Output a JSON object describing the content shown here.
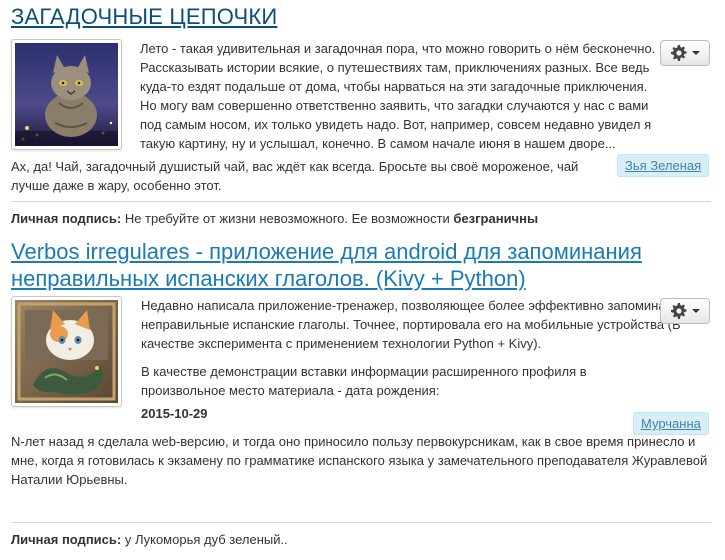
{
  "post1": {
    "title": "ЗАГАДОЧНЫЕ ЦЕПОЧКИ",
    "intro": "Лето - такая удивительная и загадочная пора, что можно говорить о нём бесконечно. Рассказывать истории всякие, о путешествиях там, приключениях разных. Все ведь куда-то ездят подальше от дома, чтобы нарваться на эти загадочные приключения. Но могу вам совершенно ответственно заявить, что загадки случаются у нас с вами под самым носом, их только увидеть надо. Вот, например, совсем недавно увидел я такую картину, ну и услышал, конечно. В самом начале июня в нашем дворе...",
    "body": "Ах, да! Чай, загадочный душистый чай, вас ждёт как всегда. Бросьте вы своё мороженое, чай лучше даже в жару, особенно этот.",
    "author": "Зья Зеленая",
    "signature_label": "Личная подпись:",
    "signature_text": " Не требуйте от жизни невозможного. Ее возможности ",
    "signature_bold": "безграничны"
  },
  "post2": {
    "title": "Verbos irregulares - приложение для android для запоминания неправильных испанских глаголов. (Kivy + Python)",
    "intro": "Недавно написала приложение-тренажер, позволяющее более эффективно запоминать неправильные испанские глаголы. Точнее, портировала его на мобильные устройства (В качестве эксперимента с применением технологии Python + Kivy).",
    "profile_note": "В качестве демонстрации вставки информации расширенного профиля в произвольное место материала - дата рождения:",
    "birth_date": "2015-10-29",
    "body": "N-лет назад я сделала web-версию, и тогда оно приносило пользу первокурсникам, как в свое время принесло и мне, когда я готовилась к экзамену по грамматике испанского языка у замечательного преподавателя Журавлевой Наталии Юрьевны.",
    "author": "Мурчанна",
    "signature_label": "Личная подпись:",
    "signature_text": " у Лукоморья дуб зеленый.."
  },
  "colors": {
    "title_dark": "#0a4f78",
    "title_link": "#1a7ab5",
    "badge_bg": "#d9edf7",
    "badge_text": "#3a87ad"
  },
  "icons": {
    "settings": "gear-icon",
    "dropdown": "caret-down-icon"
  }
}
